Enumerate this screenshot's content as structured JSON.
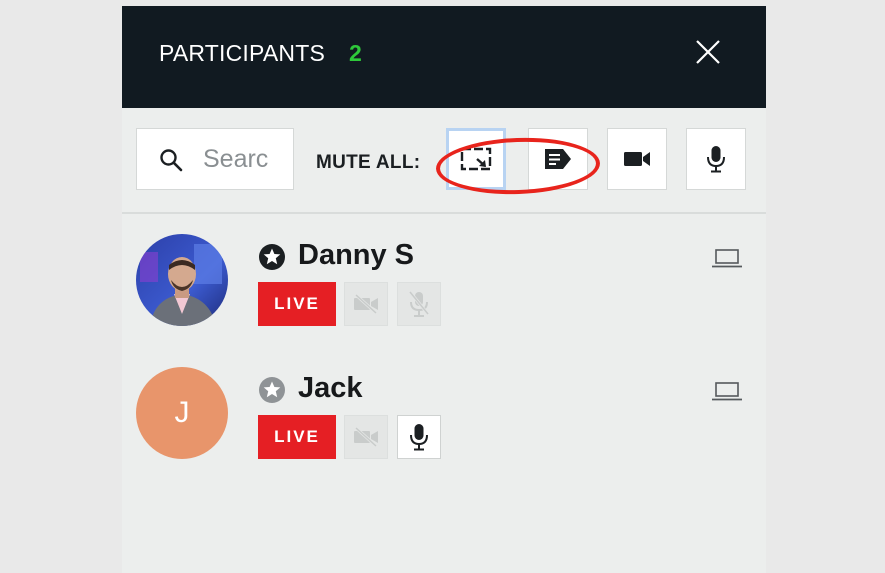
{
  "header": {
    "title": "PARTICIPANTS",
    "count": "2",
    "close_icon": "close-icon"
  },
  "toolbar": {
    "search_placeholder": "Searc",
    "mute_all_label": "MUTE ALL:",
    "buttons": [
      {
        "icon": "screen-share-icon",
        "selected": true
      },
      {
        "icon": "chat-icon",
        "selected": false
      },
      {
        "icon": "video-camera-icon",
        "selected": false
      },
      {
        "icon": "microphone-icon",
        "selected": false
      }
    ]
  },
  "participants": [
    {
      "name": "Danny S",
      "role_icon": "star-icon",
      "role_color": "#1b1f22",
      "live_label": "LIVE",
      "video": "off",
      "mic": "off",
      "device_icon": "laptop-icon",
      "avatar": "photo"
    },
    {
      "name": "Jack",
      "avatar_letter": "J",
      "role_icon": "star-icon",
      "role_color": "#8f9396",
      "live_label": "LIVE",
      "video": "off",
      "mic": "on",
      "device_icon": "laptop-icon",
      "avatar_color": "#e8956b"
    }
  ],
  "colors": {
    "header_bg": "#111a21",
    "count": "#2ec83a",
    "live": "#e51f24",
    "highlight": "#e8241c"
  }
}
